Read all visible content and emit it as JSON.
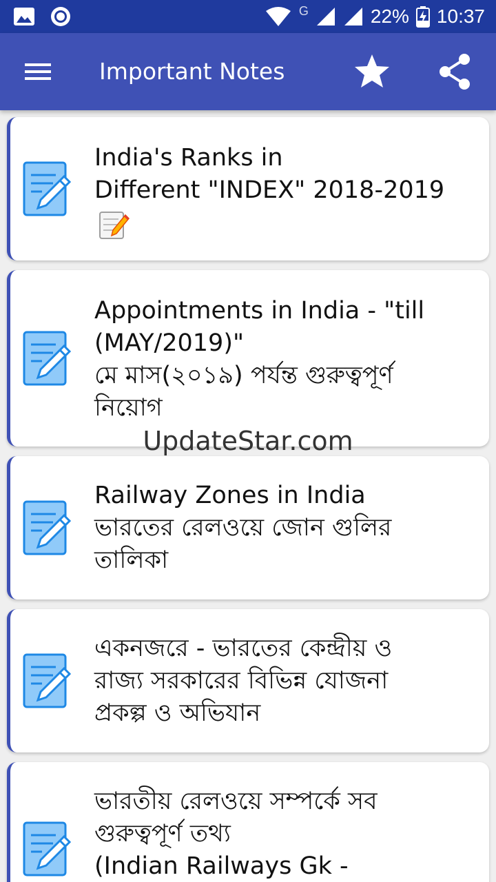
{
  "status_bar": {
    "network_label": "G",
    "battery": "22%",
    "time": "10:37",
    "icons": [
      "image-icon",
      "circle-record-icon",
      "wifi-icon",
      "signal-icon",
      "signal-icon",
      "battery-charging-icon"
    ]
  },
  "app_bar": {
    "title": "Important Notes",
    "menu_icon": "hamburger-menu-icon",
    "star_icon": "star-icon",
    "share_icon": "share-icon",
    "color": "#3f51b5"
  },
  "notes": [
    {
      "title": "India's Ranks in\nDifferent \"INDEX\" 2018-2019",
      "emoji": "memo-icon"
    },
    {
      "title": "Appointments in India - \"till\n(MAY/2019)\"\nমে মাস(২০১৯) পর্যন্ত গুরুত্বপূর্ণ\nনিয়োগ"
    },
    {
      "title": "Railway Zones in India\nভারতের রেলওয়ে জোন গুলির\nতালিকা"
    },
    {
      "title": "একনজরে - ভারতের কেন্দ্রীয় ও\nরাজ্য সরকারের বিভিন্ন যোজনা\nপ্রকল্প ও অভিযান"
    },
    {
      "title": "ভারতীয় রেলওয়ে সম্পর্কে সব\nগুরুত্বপূর্ণ তথ্য\n(Indian Railways Gk -"
    }
  ],
  "watermark": "UpdateStar.com"
}
